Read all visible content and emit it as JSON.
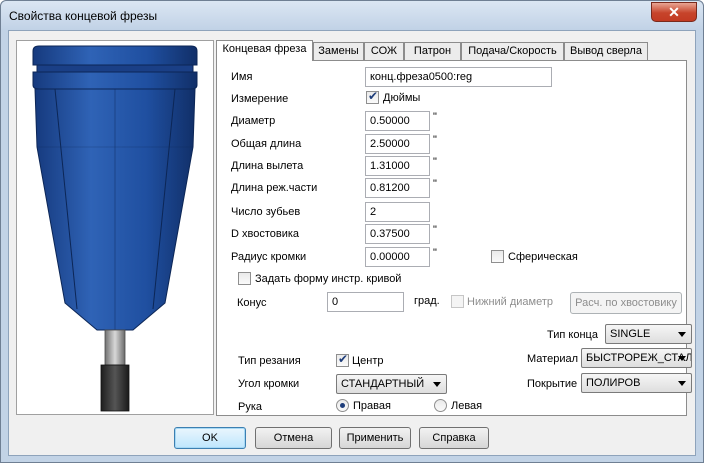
{
  "window": {
    "title": "Свойства концевой фрезы",
    "close_glyph": "✕"
  },
  "tabs": [
    {
      "label": "Концевая фреза",
      "active": true
    },
    {
      "label": "Замены"
    },
    {
      "label": "СОЖ"
    },
    {
      "label": "Патрон"
    },
    {
      "label": "Подача/Скорость"
    },
    {
      "label": "Вывод сверла"
    }
  ],
  "fields": {
    "name": {
      "label": "Имя",
      "value": "конц.фреза0500:reg"
    },
    "units": {
      "label": "Измерение",
      "checkbox_label": "Дюймы",
      "checked": true
    },
    "diameter": {
      "label": "Диаметр",
      "value": "0.50000",
      "unit": "\""
    },
    "overall_length": {
      "label": "Общая длина",
      "value": "2.50000",
      "unit": "\""
    },
    "stickout_length": {
      "label": "Длина вылета",
      "value": "1.31000",
      "unit": "\""
    },
    "cutting_length": {
      "label": "Длина реж.части",
      "value": "0.81200",
      "unit": "\""
    },
    "flutes": {
      "label": "Число зубьев",
      "value": "2"
    },
    "shank_diameter": {
      "label": "D хвостовика",
      "value": "0.37500",
      "unit": "\""
    },
    "corner_radius": {
      "label": "Радиус кромки",
      "value": "0.00000",
      "unit": "\""
    },
    "spherical": {
      "label": "Сферическая",
      "checked": false
    },
    "curve_shape": {
      "label": "Задать форму инстр. кривой",
      "checked": false
    },
    "taper": {
      "label": "Конус",
      "value": "0",
      "unit": "град."
    },
    "lower_diameter": {
      "label": "Нижний диаметр",
      "checked": false,
      "disabled": true
    },
    "calc_shank": {
      "label": "Расч. по хвостовику",
      "disabled": true
    },
    "end_type": {
      "label": "Тип конца",
      "value": "SINGLE"
    },
    "cut_type": {
      "label": "Тип резания",
      "checkbox_label": "Центр",
      "checked": true
    },
    "material": {
      "label": "Материал",
      "value": "БЫСТРОРЕЖ_СТАЛЬ"
    },
    "edge_angle": {
      "label": "Угол кромки",
      "value": "СТАНДАРТНЫЙ"
    },
    "coating": {
      "label": "Покрытие",
      "value": "ПОЛИРОВ"
    },
    "hand": {
      "label": "Рука",
      "right": "Правая",
      "left": "Левая",
      "selected": "right"
    }
  },
  "buttons": {
    "ok": "OK",
    "cancel": "Отмена",
    "apply": "Применить",
    "help": "Справка"
  },
  "colors": {
    "holder_blue": "#1f4fa0",
    "title_bg": "#c1d2e6"
  }
}
